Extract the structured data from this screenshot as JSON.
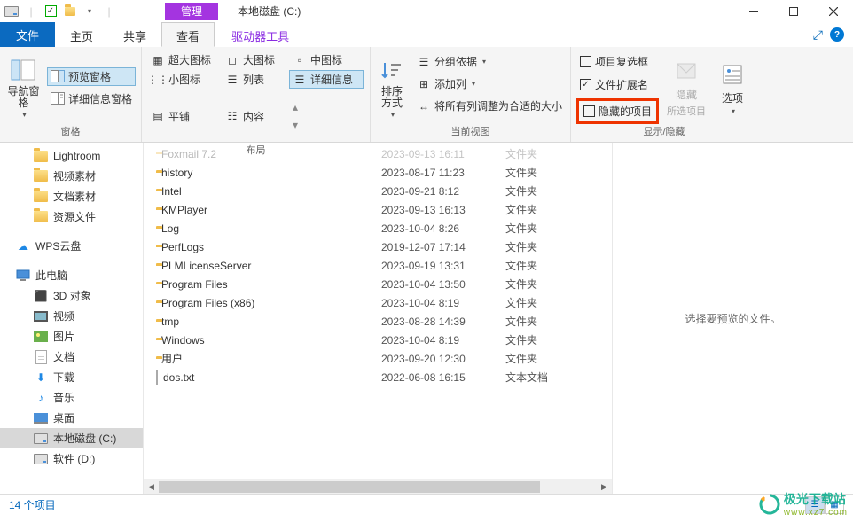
{
  "titlebar": {
    "contextual_tab": "管理",
    "window_title": "本地磁盘 (C:)"
  },
  "tabs": {
    "file": "文件",
    "home": "主页",
    "share": "共享",
    "view": "查看",
    "drivetools": "驱动器工具"
  },
  "ribbon": {
    "panes_group": "窗格",
    "nav_pane": "导航窗格",
    "preview_pane": "预览窗格",
    "details_pane": "详细信息窗格",
    "layout_group": "布局",
    "extra_large": "超大图标",
    "large_icons": "大图标",
    "medium_icons": "中图标",
    "small_icons": "小图标",
    "list_view": "列表",
    "details_view": "详细信息",
    "tiles_view": "平铺",
    "content_view": "内容",
    "current_view_group": "当前视图",
    "sort_by": "排序方式",
    "group_by": "分组依据",
    "add_columns": "添加列",
    "size_all_cols": "将所有列调整为合适的大小",
    "showhide_group": "显示/隐藏",
    "item_checkboxes": "项目复选框",
    "file_ext": "文件扩展名",
    "hidden_items": "隐藏的项目",
    "hide_btn": "隐藏",
    "hide_btn_sub": "所选项目",
    "options": "选项"
  },
  "sidebar": {
    "lightroom": "Lightroom",
    "video_material": "视频素材",
    "doc_material": "文档素材",
    "resource_files": "资源文件",
    "wps_cloud": "WPS云盘",
    "this_pc": "此电脑",
    "objects_3d": "3D 对象",
    "videos": "视频",
    "pictures": "图片",
    "documents": "文档",
    "downloads": "下载",
    "music": "音乐",
    "desktop": "桌面",
    "local_c": "本地磁盘 (C:)",
    "software_d": "软件 (D:)"
  },
  "files": [
    {
      "name": "Foxmail 7.2",
      "date": "2023-09-13 16:11",
      "type": "文件夹"
    },
    {
      "name": "history",
      "date": "2023-08-17 11:23",
      "type": "文件夹"
    },
    {
      "name": "Intel",
      "date": "2023-09-21 8:12",
      "type": "文件夹"
    },
    {
      "name": "KMPlayer",
      "date": "2023-09-13 16:13",
      "type": "文件夹"
    },
    {
      "name": "Log",
      "date": "2023-10-04 8:26",
      "type": "文件夹"
    },
    {
      "name": "PerfLogs",
      "date": "2019-12-07 17:14",
      "type": "文件夹"
    },
    {
      "name": "PLMLicenseServer",
      "date": "2023-09-19 13:31",
      "type": "文件夹"
    },
    {
      "name": "Program Files",
      "date": "2023-10-04 13:50",
      "type": "文件夹"
    },
    {
      "name": "Program Files (x86)",
      "date": "2023-10-04 8:19",
      "type": "文件夹"
    },
    {
      "name": "tmp",
      "date": "2023-08-28 14:39",
      "type": "文件夹"
    },
    {
      "name": "Windows",
      "date": "2023-10-04 8:19",
      "type": "文件夹"
    },
    {
      "name": "用户",
      "date": "2023-09-20 12:30",
      "type": "文件夹"
    },
    {
      "name": "dos.txt",
      "date": "2022-06-08 16:15",
      "type": "文本文档",
      "icon": "file"
    }
  ],
  "preview_msg": "选择要预览的文件。",
  "status": "14 个项目",
  "watermark": {
    "main": "极光下载站",
    "sub": "www.xz7.com"
  }
}
